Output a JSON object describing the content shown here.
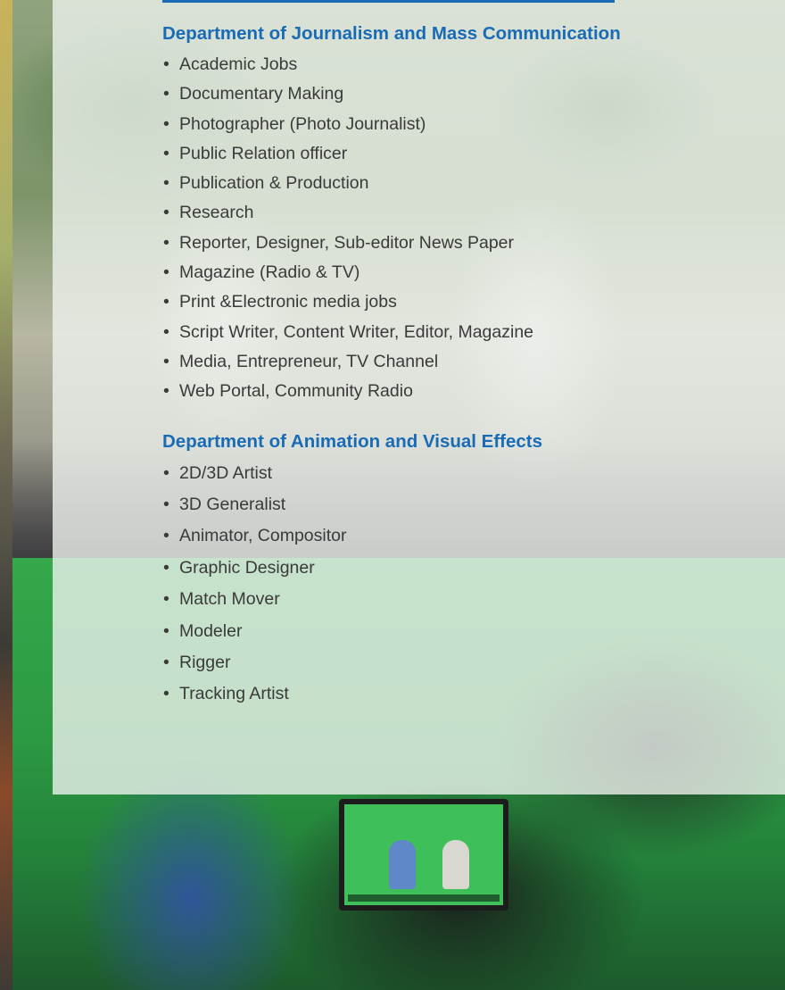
{
  "sections": [
    {
      "heading": "Department of Journalism and Mass Communication",
      "items": [
        "Academic Jobs",
        "Documentary Making",
        "Photographer (Photo Journalist)",
        "Public Relation officer",
        "Publication & Production",
        "Research",
        "Reporter, Designer, Sub-editor News Paper",
        "Magazine (Radio & TV)",
        "Print &Electronic media jobs",
        "Script Writer, Content Writer, Editor, Magazine",
        "Media, Entrepreneur, TV Channel",
        "Web Portal, Community Radio"
      ]
    },
    {
      "heading": "Department of Animation and Visual Effects",
      "items": [
        "2D/3D Artist",
        "3D Generalist",
        "Animator, Compositor",
        "Graphic Designer",
        "Match Mover",
        "Modeler",
        "Rigger",
        "Tracking  Artist"
      ]
    }
  ],
  "colors": {
    "heading": "#1a6bb5",
    "body_text": "#3a3a3a",
    "panel": "#ecf1ec"
  },
  "bullet_glyph": "•"
}
